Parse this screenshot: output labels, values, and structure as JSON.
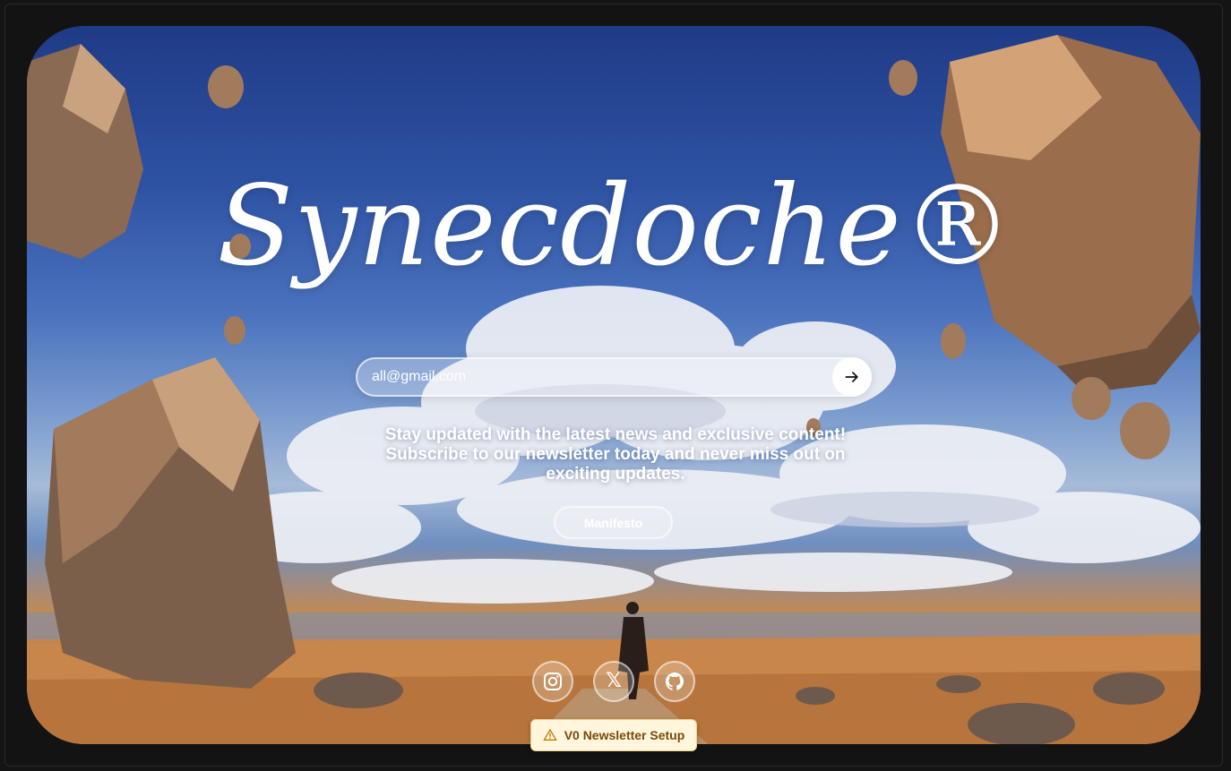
{
  "brand": {
    "title": "Synecdoche®"
  },
  "newsletter": {
    "email_value": "all@gmail.com",
    "email_placeholder": "all@gmail.com",
    "tagline": "Stay updated with the latest news and exclusive content! Subscribe to our newsletter today and never miss out on exciting updates."
  },
  "actions": {
    "manifesto_label": "Manifesto"
  },
  "social": [
    {
      "name": "instagram",
      "icon": "instagram-icon"
    },
    {
      "name": "x",
      "icon": "x-icon",
      "glyph": "𝕏"
    },
    {
      "name": "github",
      "icon": "github-icon"
    }
  ],
  "notice": {
    "label": "V0 Newsletter Setup",
    "icon": "warning-icon"
  },
  "colors": {
    "notice_bg": "#fff6dd",
    "notice_text": "#7a4a0c",
    "sky": "#2e52a3",
    "ground": "#c48a52"
  }
}
